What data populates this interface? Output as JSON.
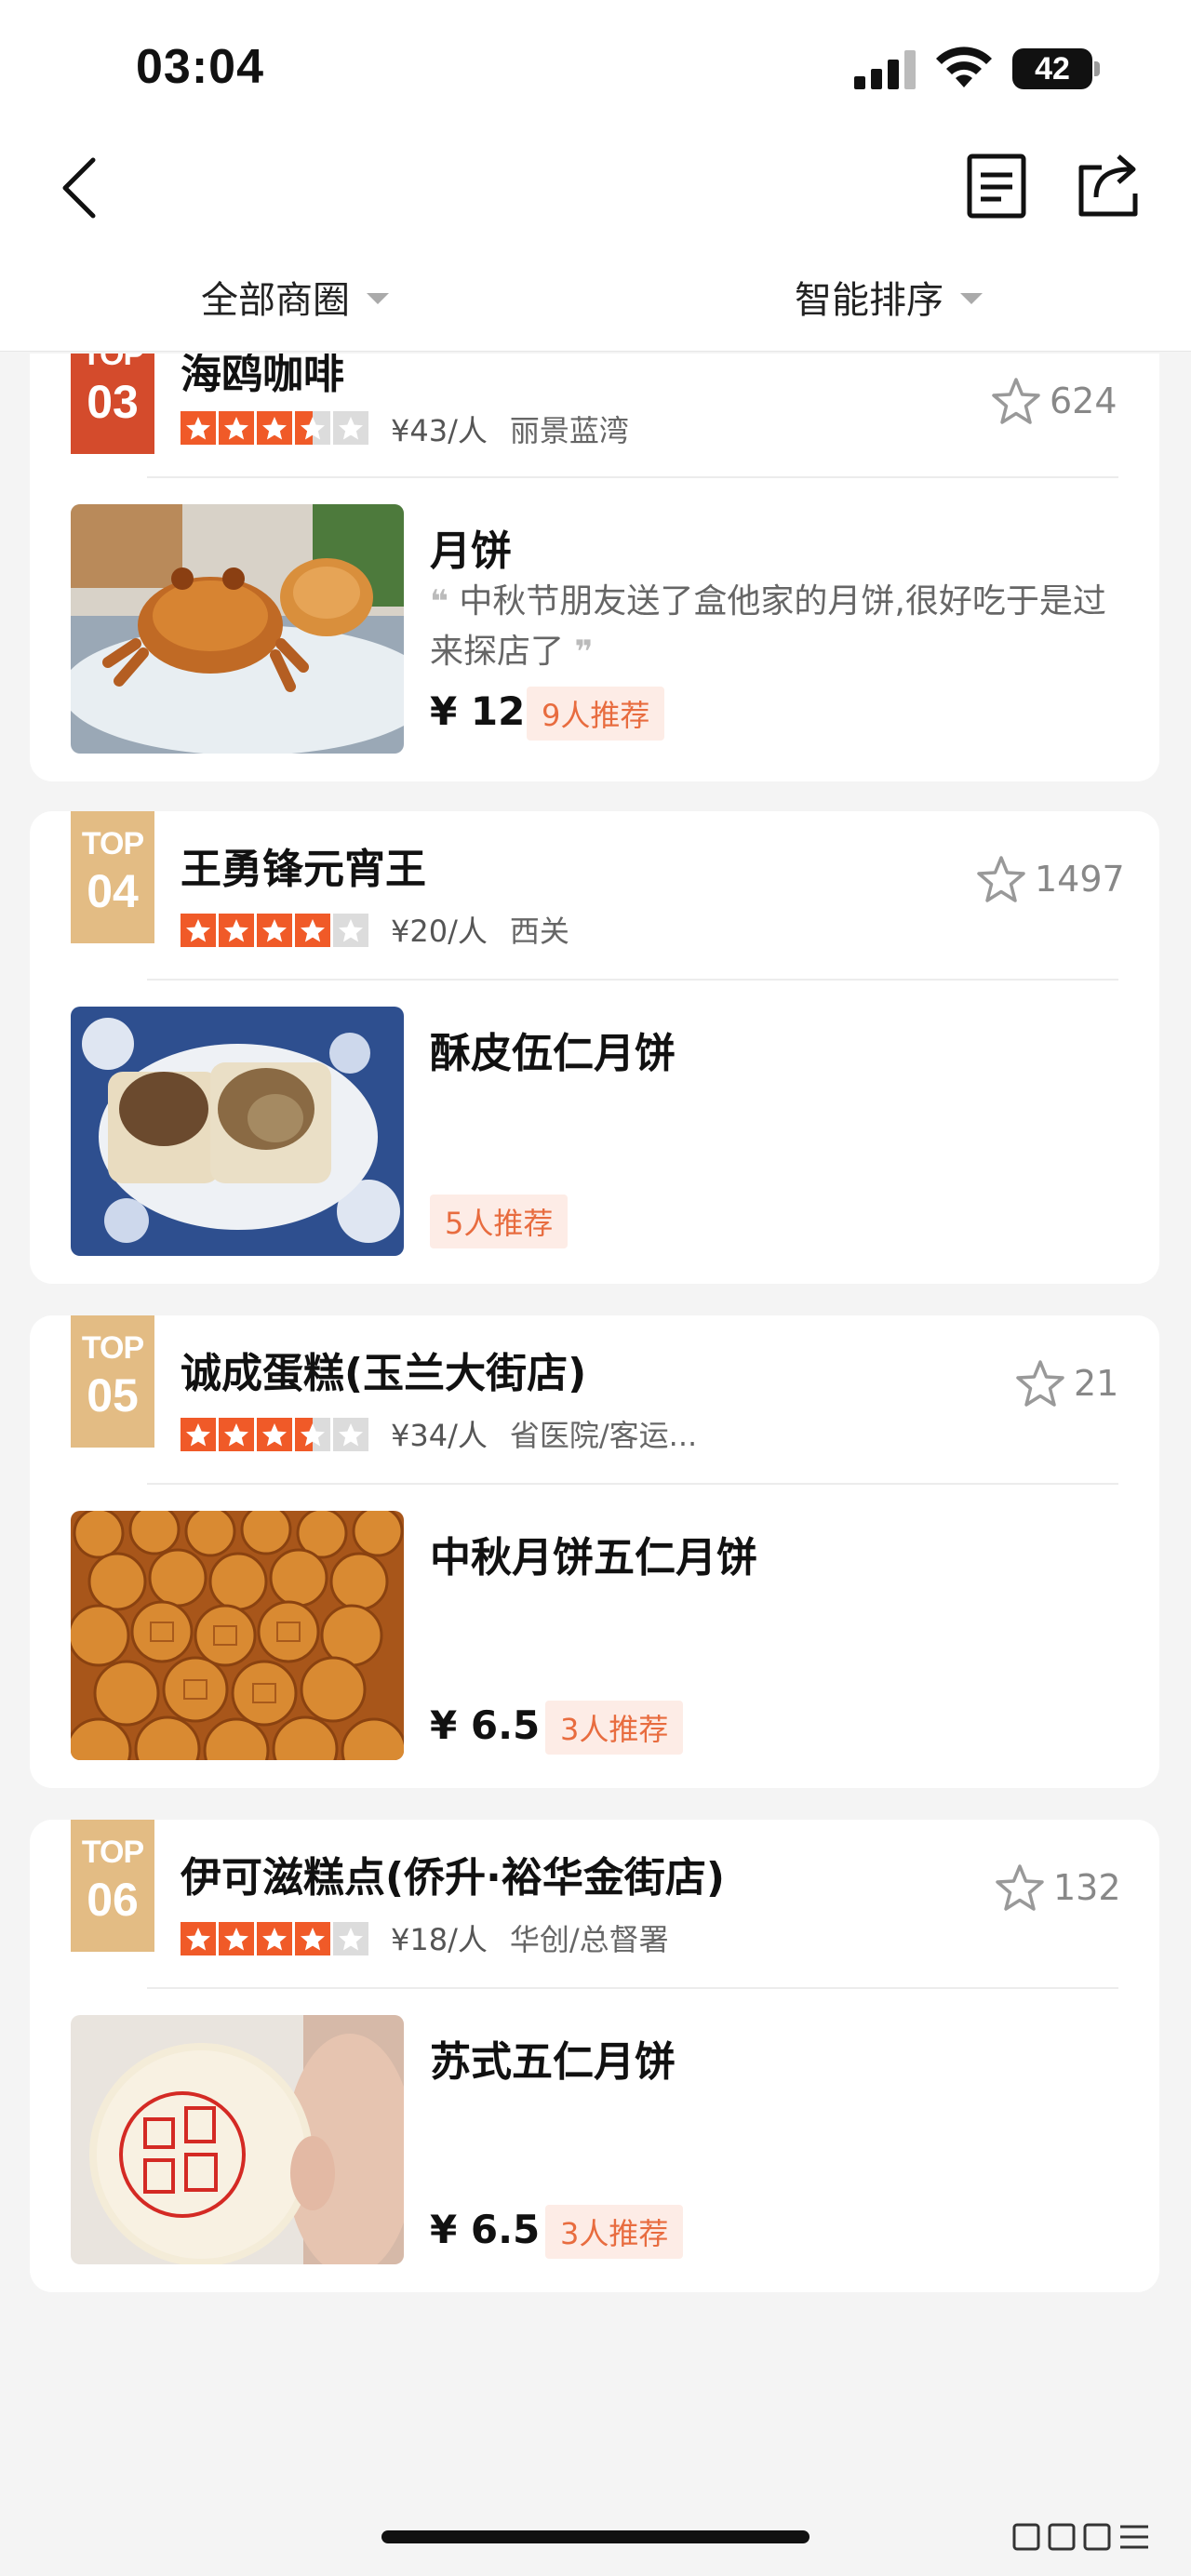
{
  "status": {
    "time": "03:04",
    "battery": "42"
  },
  "filters": {
    "area": "全部商圈",
    "sort": "智能排序"
  },
  "colors": {
    "accent": "#e86c3f",
    "star_active": "#f05a28",
    "badge_top3": "#d44b2c",
    "badge": "#e3bc84"
  },
  "cards": [
    {
      "rank_top": "TOP",
      "rank_num": "03",
      "shop": "海鸥咖啡",
      "rating": 3.5,
      "per_person": "¥43/人",
      "area": "丽景蓝湾",
      "favorites": "624",
      "dish": "月饼",
      "review": "中秋节朋友送了盒他家的月饼,很好吃于是过来探店了",
      "price": "¥ 12",
      "recommend": "9人推荐"
    },
    {
      "rank_top": "TOP",
      "rank_num": "04",
      "shop": "王勇锋元宵王",
      "rating": 4,
      "per_person": "¥20/人",
      "area": "西关",
      "favorites": "1497",
      "dish": "酥皮伍仁月饼",
      "price": "",
      "recommend": "5人推荐"
    },
    {
      "rank_top": "TOP",
      "rank_num": "05",
      "shop": "诚成蛋糕(玉兰大街店)",
      "rating": 3.5,
      "per_person": "¥34/人",
      "area": "省医院/客运...",
      "favorites": "21",
      "dish": "中秋月饼五仁月饼",
      "price": "¥ 6.5",
      "recommend": "3人推荐"
    },
    {
      "rank_top": "TOP",
      "rank_num": "06",
      "shop": "伊可滋糕点(侨升·裕华金街店)",
      "rating": 4,
      "per_person": "¥18/人",
      "area": "华创/总督署",
      "favorites": "132",
      "dish": "苏式五仁月饼",
      "price": "¥ 6.5",
      "recommend": "3人推荐"
    }
  ]
}
